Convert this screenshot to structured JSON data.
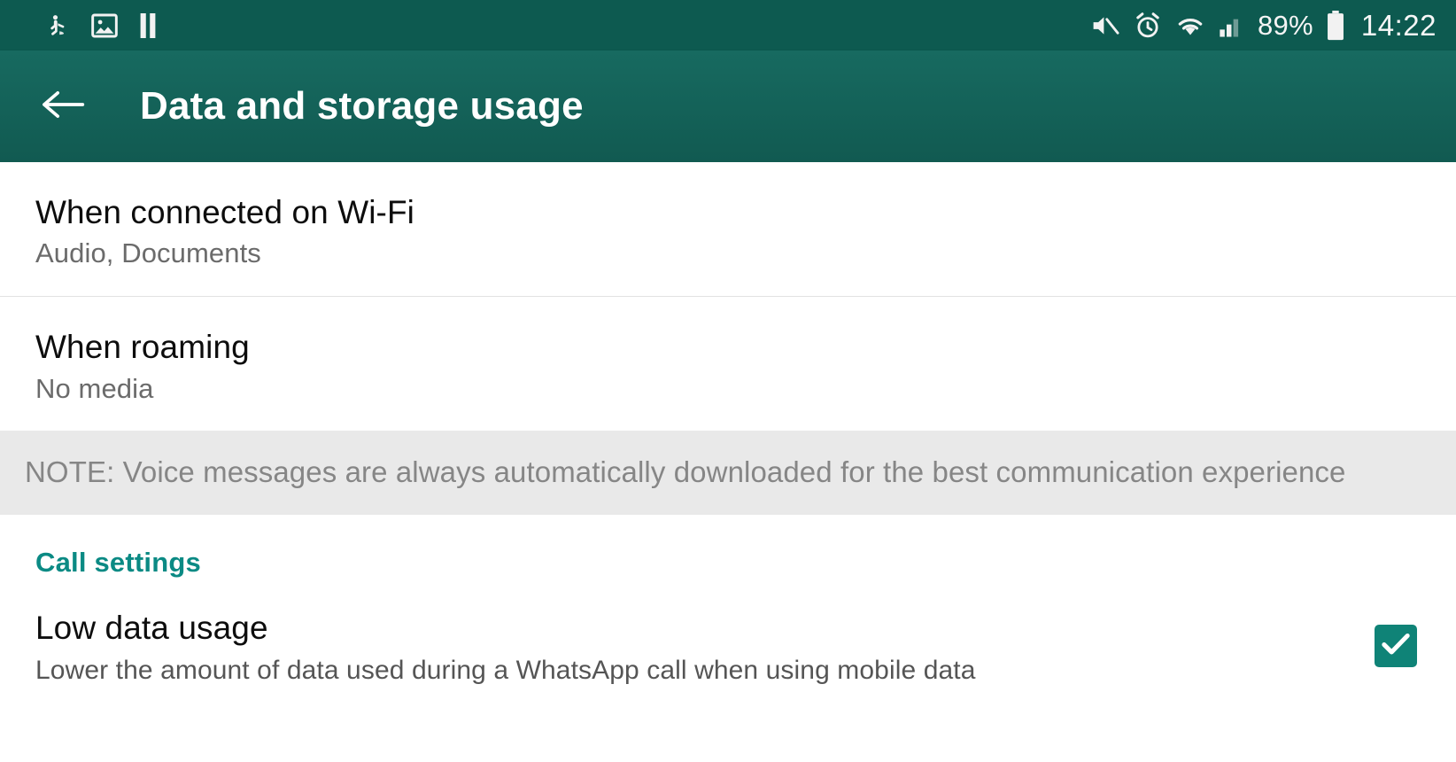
{
  "status_bar": {
    "icons_left": [
      "android-debug-icon",
      "screenshot-image-icon",
      "pause-icon"
    ],
    "icons_right": [
      "mute-icon",
      "alarm-clock-icon",
      "wifi-icon",
      "cellular-signal-icon",
      "battery-icon"
    ],
    "battery_percent": "89%",
    "clock": "14:22",
    "background_color": "#0d5a50"
  },
  "app_bar": {
    "back_icon": "arrow-left-icon",
    "title": "Data and storage usage",
    "background_color": "#15625a"
  },
  "settings": {
    "items": [
      {
        "primary": "When connected on Wi-Fi",
        "secondary": "Audio, Documents"
      },
      {
        "primary": "When roaming",
        "secondary": "No media"
      }
    ],
    "note": "NOTE: Voice messages are always automatically downloaded for the best communication experience",
    "note_background_color": "#e9e9e9",
    "section": {
      "title": "Call settings",
      "accent_color": "#0b8a84"
    },
    "toggle": {
      "primary": "Low data usage",
      "secondary": "Lower the amount of data used during a WhatsApp call when using mobile data",
      "checked": true,
      "checkbox_color": "#0f8377",
      "check_icon": "check-icon"
    }
  }
}
